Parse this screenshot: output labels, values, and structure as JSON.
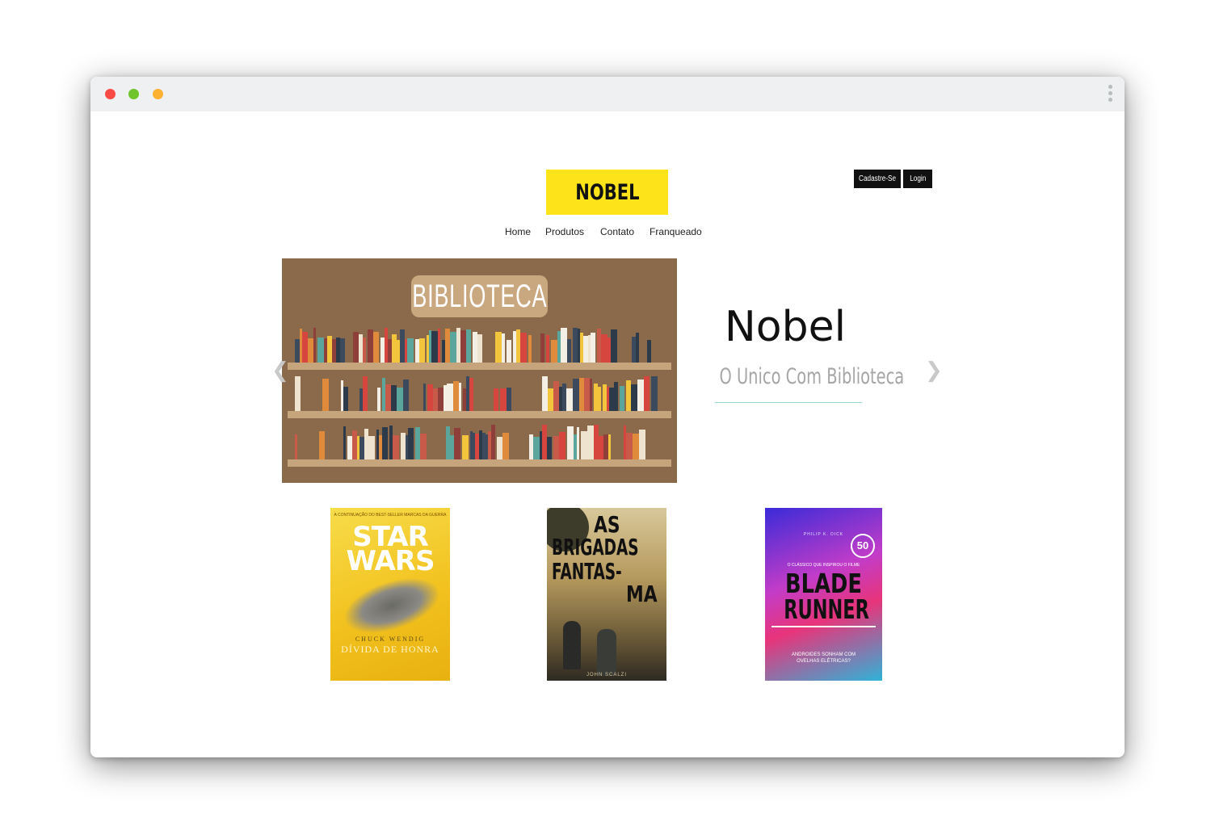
{
  "browser": {
    "window_controls": [
      "close",
      "minimize",
      "maximize"
    ],
    "menu_icon": "kebab-menu-icon"
  },
  "header": {
    "logo": "NOBEL",
    "signup_label": "Cadastre-Se",
    "login_label": "Login"
  },
  "nav": {
    "items": [
      "Home",
      "Produtos",
      "Contato",
      "Franqueado"
    ]
  },
  "carousel": {
    "image_label": "BIBLIOTECA",
    "title": "Nobel",
    "subtitle": "O Unico Com Biblioteca",
    "prev_icon": "chevron-left-icon",
    "next_icon": "chevron-right-icon"
  },
  "books": [
    {
      "top_line": "A CONTINUAÇÃO DO BEST-SELLER MARCAS DA GUERRA",
      "title_1": "STAR",
      "title_2": "WARS",
      "author": "CHUCK WENDIG",
      "subtitle": "DÍVIDA DE HONRA"
    },
    {
      "title_1": "AS",
      "title_2": "BRIGADAS",
      "title_3": "FANTAS-",
      "title_4": "MA",
      "author": "JOHN SCALZI"
    },
    {
      "author": "PHILIP K. DICK",
      "badge": "50",
      "tagline": "O CLÁSSICO QUE INSPIROU O FILME",
      "title_1": "BLADE",
      "title_2": "RUNNER",
      "bottom_line": "ANDROIDES SONHAM COM OVELHAS ELÉTRICAS?"
    }
  ],
  "colors": {
    "logo_bg": "#fde41a",
    "hero_bg": "#8a6a4b",
    "button_bg": "#111111",
    "accent_line": "#9ad7d4"
  }
}
